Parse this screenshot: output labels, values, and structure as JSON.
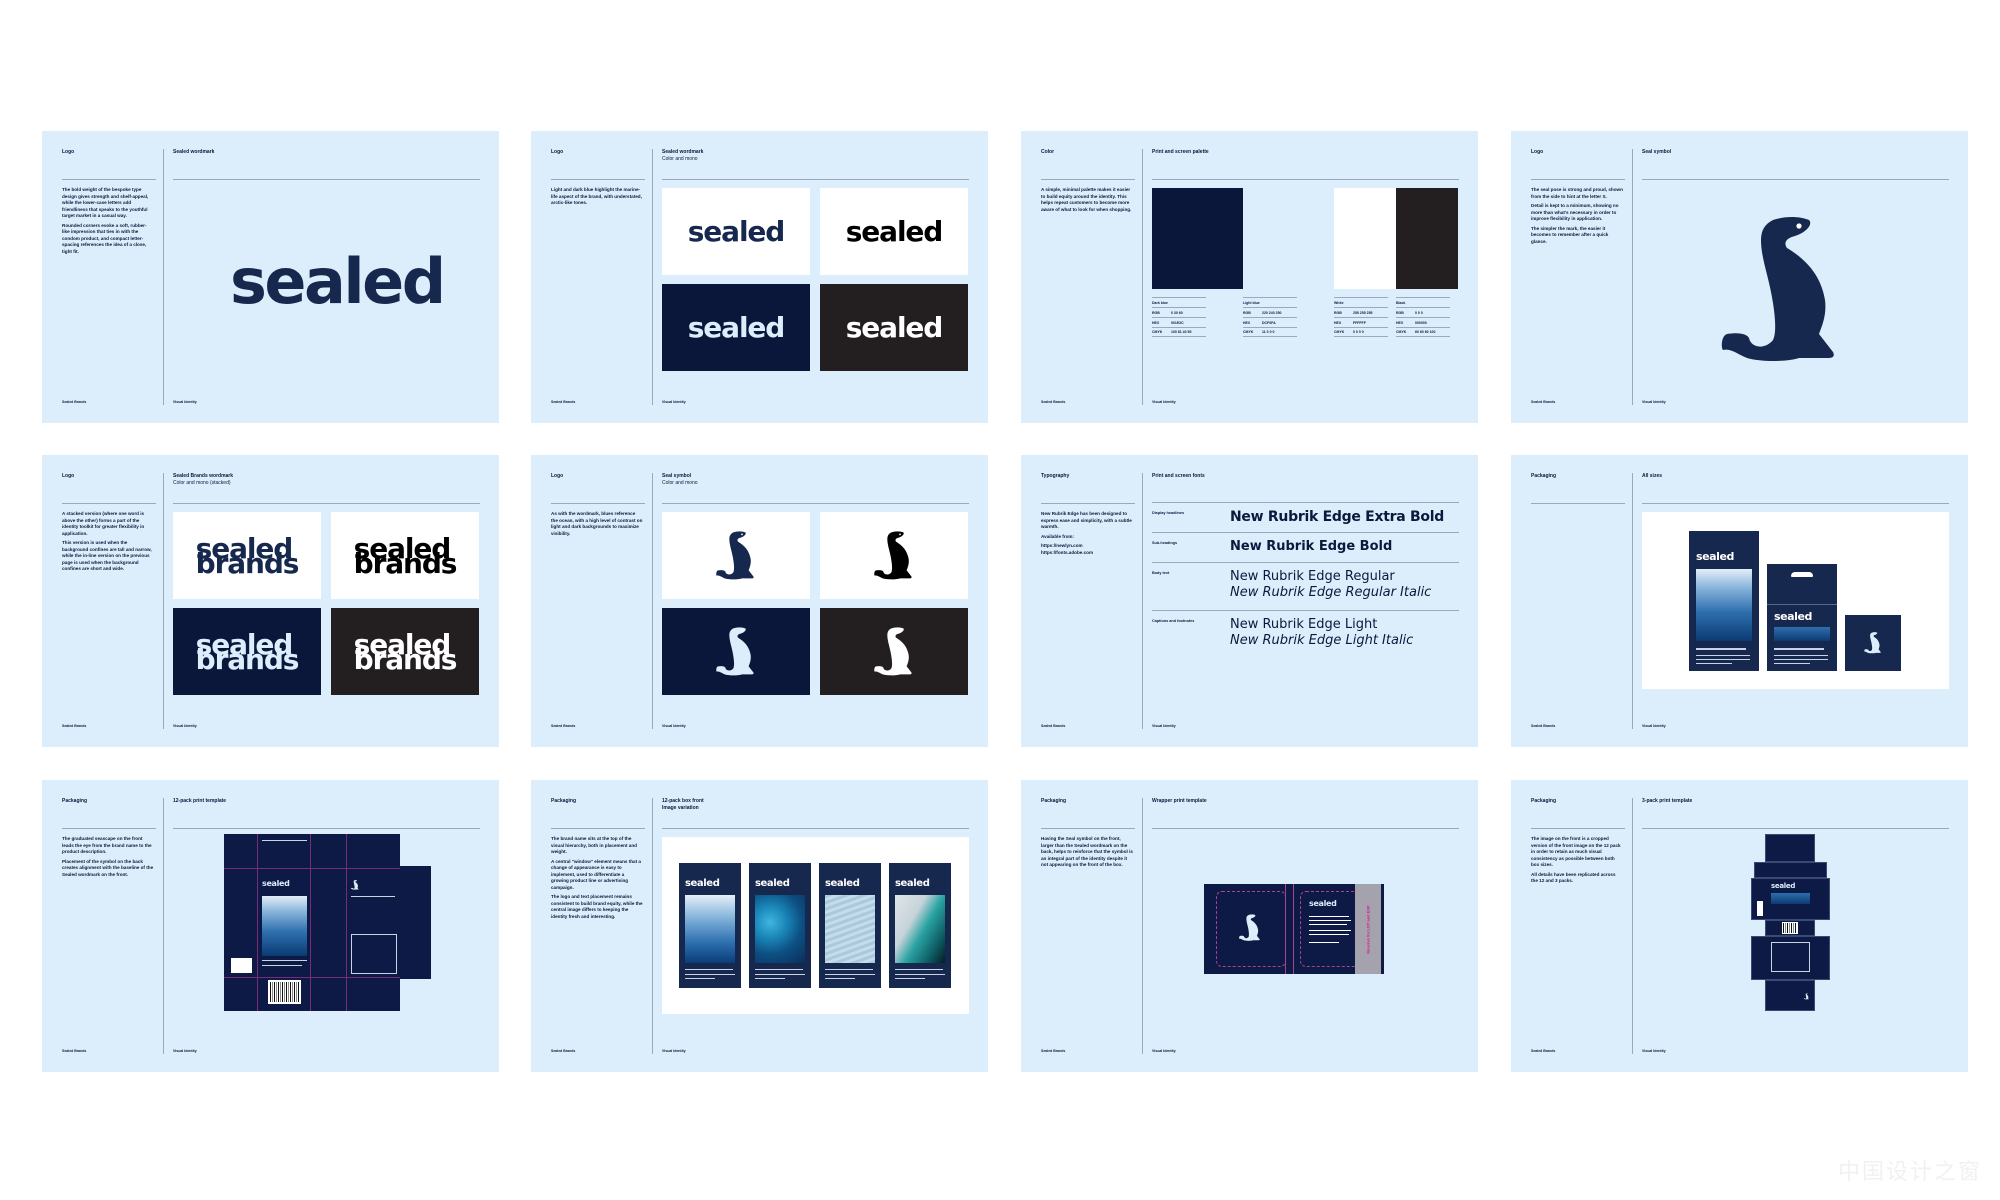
{
  "document": {
    "footer_left": "Sealed Brands",
    "footer_right": "Visual Identity"
  },
  "colors": {
    "panel_bg": "#dcedfb",
    "dark_blue": "#0a173b",
    "logo_blue": "#17284f",
    "light_blue": "#dcedfb",
    "white": "#ffffff",
    "black": "#231f20",
    "dieline_magenta": "#e0148c"
  },
  "panels": [
    {
      "section": "Logo",
      "title": "Sealed wordmark",
      "subtitle": "",
      "description": [
        "The bold weight of the bespoke type design gives strength and shelf-appeal, while the lower-case letters add friendliness that speaks to the youthful target market in a casual way.",
        "Rounded corners evoke a soft, rubber-like impression that ties in with the condom product, and compact letter-spacing references the idea of a close, tight fit."
      ],
      "wordmark": "sealed"
    },
    {
      "section": "Logo",
      "title": "Sealed wordmark",
      "subtitle": "Color and mono",
      "description": [
        "Light and dark blue highlight the marine-life aspect of the brand, with understated, arctic-like tones."
      ],
      "tiles": [
        "sealed",
        "sealed",
        "sealed",
        "sealed"
      ]
    },
    {
      "section": "Color",
      "title": "Print and screen palette",
      "subtitle": "",
      "description": [
        "A simple, minimal palette makes it easier to build equity around the identity. This helps repeat customers to become more aware of what to look for when shopping."
      ],
      "palette": [
        {
          "name": "Dark blue",
          "rgb": "0 30 60",
          "hex": "001E3C",
          "cmyk": "100 81 40 55"
        },
        {
          "name": "Light blue",
          "rgb": "220 240 250",
          "hex": "DCF0FA",
          "cmyk": "11 0 0 0"
        },
        {
          "name": "White",
          "rgb": "255 255 255",
          "hex": "FFFFFF",
          "cmyk": "0 0 0 0"
        },
        {
          "name": "Black",
          "rgb": "0 0 0",
          "hex": "000000",
          "cmyk": "60 60 60 100"
        }
      ],
      "row_labels": {
        "rgb": "RGB",
        "hex": "HEX",
        "cmyk": "CMYK"
      }
    },
    {
      "section": "Logo",
      "title": "Seal symbol",
      "subtitle": "",
      "description": [
        "The seal pose is strong and proud, shown from the side to hint at the letter S.",
        "Detail is kept to a minimum, showing no more than what's necessary in order to improve flexibility in application.",
        "The simpler the mark, the easier it becomes to remember after a quick glance."
      ]
    },
    {
      "section": "Logo",
      "title": "Sealed Brands wordmark",
      "subtitle": "Color and mono (stacked)",
      "description": [
        "A stacked version (where one word is above the other) forms a part of the identity toolkit for greater flexibility in application.",
        "This version is used when the background confines are tall and narrow, while the in-line version on the previous page is used when the background confines are short and wide."
      ],
      "stack_line1": "sealed",
      "stack_line2": "brands"
    },
    {
      "section": "Logo",
      "title": "Seal symbol",
      "subtitle": "Color and mono",
      "description": [
        "As with the wordmark, blues reference the ocean, with a high level of contrast on light and dark backgrounds to maximize visibility."
      ]
    },
    {
      "section": "Typography",
      "title": "Print and screen fonts",
      "subtitle": "",
      "description": [
        "New Rubrik Edge has been designed to express ease and simplicity, with a subtle warmth.",
        "Available from:",
        "https://newlyn.com\nhttps://fonts.adobe.com"
      ],
      "font_rows": [
        {
          "label": "Display headlines",
          "samples": [
            "New Rubrik Edge Extra Bold"
          ]
        },
        {
          "label": "Sub-headings",
          "samples": [
            "New Rubrik Edge Bold"
          ]
        },
        {
          "label": "Body text",
          "samples": [
            "New Rubrik Edge Regular",
            "New Rubrik Edge Regular Italic"
          ]
        },
        {
          "label": "Captions and footnotes",
          "samples": [
            "New Rubrik Edge Light",
            "New Rubrik Edge Light Italic"
          ]
        }
      ]
    },
    {
      "section": "Packaging",
      "title": "All sizes",
      "subtitle": "",
      "description": [],
      "pack_wordmark": "sealed"
    },
    {
      "section": "Packaging",
      "title": "12-pack print template",
      "subtitle": "",
      "description": [
        "The graduated seascape on the front leads the eye from the brand name to the product description.",
        "Placement of the symbol on the back creates alignment with the baseline of the Sealed wordmark on the front."
      ],
      "pack_wordmark": "sealed"
    },
    {
      "section": "Packaging",
      "title": "12-pack box front",
      "subtitle": "Image variation",
      "description": [
        "The brand name sits at the top of the visual hierarchy, both in placement and weight.",
        "A central \"window\" element means that a change of appearance is easy to implement, used to differentiate a growing product line or advertising campaign.",
        "The logo and text placement remains consistent to build brand equity, while the central image differs to keeping the identity fresh and interesting."
      ],
      "variations": [
        "sealed",
        "sealed",
        "sealed",
        "sealed"
      ]
    },
    {
      "section": "Packaging",
      "title": "Wrapper print template",
      "subtitle": "",
      "description": [
        "Having the Seal symbol on the front, larger than the Sealed wordmark on the back, helps to reinforce that the symbol is an integral part of the identity despite it not appearing on the front of the box."
      ],
      "pack_wordmark": "sealed",
      "reserve_label": "Reserve for LOT and EXP"
    },
    {
      "section": "Packaging",
      "title": "3-pack print template",
      "subtitle": "",
      "description": [
        "The image on the front is a cropped version of the front image on the 12 pack in order to retain as much visual consistency as possible between both box sizes.",
        "All details have been replicated across the 12 and 3 packs."
      ],
      "pack_wordmark": "sealed"
    }
  ],
  "watermark": "中国设计之窗"
}
